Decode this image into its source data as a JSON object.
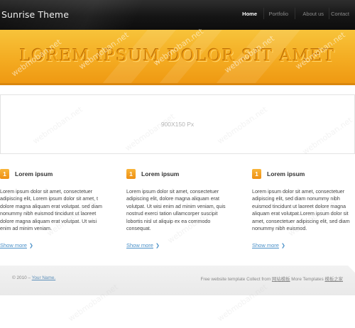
{
  "header": {
    "logo": "Sunrise Theme",
    "nav": [
      {
        "label": "Home",
        "active": true
      },
      {
        "label": "Portfolio",
        "active": false
      },
      {
        "label": "About us",
        "active": false
      },
      {
        "label": "Contact",
        "active": false
      }
    ]
  },
  "banner": {
    "title": "LOREM IPSUM DOLOR SIT AMET",
    "accent_color": "#f4ac22"
  },
  "placeholder": {
    "label": "900X150 Px"
  },
  "columns": [
    {
      "number": "1",
      "title": "Lorem ipsum",
      "text": "Lorem ipsum dolor sit amet, consectetuer adipiscing elit, Lorem ipsum dolor sit amet, t dolore magna aliquam erat volutpat. sed diam nonummy nibh euismod tincidunt ut laoreet dolore magna aliquam erat volutpat. Ut wisi enim ad minim veniam.",
      "link": "Show more"
    },
    {
      "number": "1",
      "title": "Lorem ipsum",
      "text": "Lorem ipsum dolor sit amet, consectetuer adipiscing elit, dolore magna aliquam erat volutpat. Ut wisi enim ad minim veniam, quis nostrud exerci tation ullamcorper suscipit lobortis nisl ut aliquip ex ea commodo consequat.",
      "link": "Show more"
    },
    {
      "number": "1",
      "title": "Lorem ipsum",
      "text": "Lorem ipsum dolor sit amet, consectetuer adipiscing elit, sed diam nonummy nibh euismod tincidunt ut laoreet dolore magna aliquam erat volutpat.Lorem ipsum dolor sit amet, consectetuer adipiscing elit, sed diam nonummy nibh euismod.",
      "link": "Show more"
    }
  ],
  "footer": {
    "copyright": "© 2010 – ",
    "name_link": "Your Name.",
    "credit_prefix": "Free website template Collect from ",
    "credit_link1": "网站模板",
    "credit_mid": " More Templates ",
    "credit_link2": "模板之家"
  },
  "watermark": "webmoban.net"
}
